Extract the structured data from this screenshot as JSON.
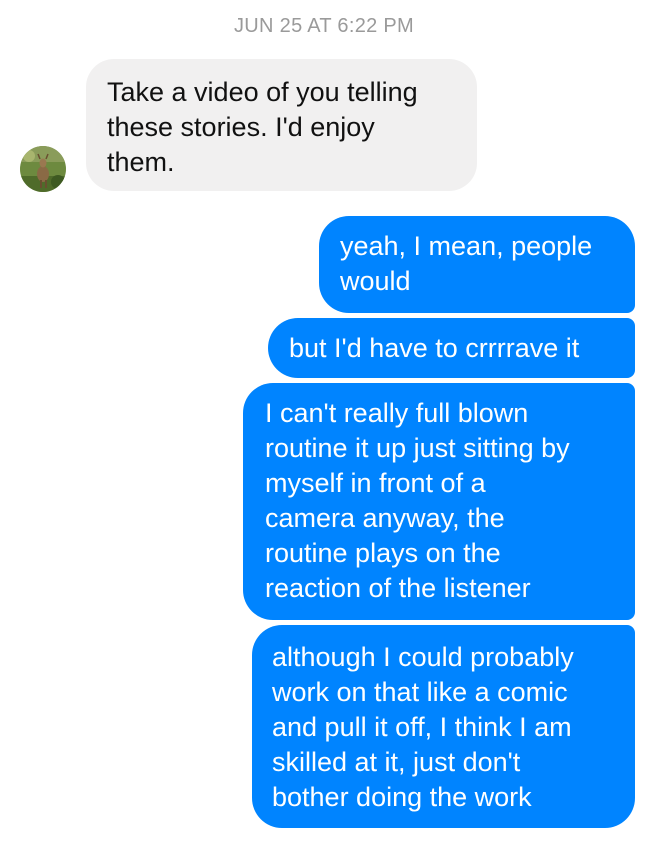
{
  "conversation": {
    "timestamp": "JUN 25 AT 6:22 PM",
    "contact": {
      "avatar_icon": "deer-photo-avatar-icon"
    },
    "messages": [
      {
        "direction": "incoming",
        "text": "Take a video of you telling\nthese stories. I'd enjoy\nthem."
      },
      {
        "direction": "outgoing",
        "text": "yeah, I mean, people\nwould"
      },
      {
        "direction": "outgoing",
        "text": "but I'd have to crrrrave it"
      },
      {
        "direction": "outgoing",
        "text": "I can't really full blown\nroutine it up just sitting by\nmyself in front of a\ncamera anyway, the\nroutine plays on the\nreaction of the listener"
      },
      {
        "direction": "outgoing",
        "text": "although I could probably\nwork on that like a comic\nand pull it off, I think I am\nskilled at it, just don't\nbother doing the work"
      }
    ]
  },
  "colors": {
    "outgoing_bubble": "#0084ff",
    "incoming_bubble": "#f1f0f0",
    "timestamp_text": "#9a9a9a"
  }
}
